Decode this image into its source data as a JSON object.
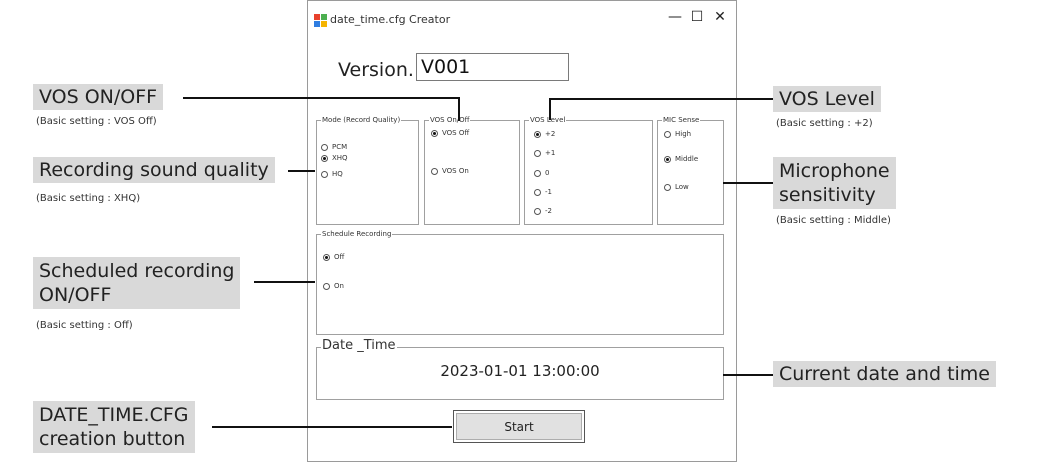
{
  "window": {
    "title": "date_time.cfg Creator",
    "controls": {
      "minimize": "—",
      "maximize": "☐",
      "close": "✕"
    },
    "icon_colors": [
      "#e8412c",
      "#4caf50",
      "#2f7de1",
      "#f5b400"
    ]
  },
  "version": {
    "label": "Version.",
    "value": "V001"
  },
  "groups": {
    "mode": {
      "title": "Mode (Record Quality)",
      "options": [
        {
          "label": "PCM",
          "selected": false
        },
        {
          "label": "XHQ",
          "selected": true
        },
        {
          "label": "HQ",
          "selected": false
        }
      ]
    },
    "vos_onoff": {
      "title": "VOS On/Off",
      "options": [
        {
          "label": "VOS Off",
          "selected": true
        },
        {
          "label": "VOS On",
          "selected": false
        }
      ]
    },
    "vos_level": {
      "title": "VOS Level",
      "options": [
        {
          "label": "+2",
          "selected": true
        },
        {
          "label": "+1",
          "selected": false
        },
        {
          "label": "0",
          "selected": false
        },
        {
          "label": "-1",
          "selected": false
        },
        {
          "label": "-2",
          "selected": false
        }
      ]
    },
    "mic_sense": {
      "title": "MIC Sense",
      "options": [
        {
          "label": "High",
          "selected": false
        },
        {
          "label": "Middle",
          "selected": true
        },
        {
          "label": "Low",
          "selected": false
        }
      ]
    },
    "schedule": {
      "title": "Schedule Recording",
      "options": [
        {
          "label": "Off",
          "selected": true
        },
        {
          "label": "On",
          "selected": false
        }
      ]
    },
    "datetime": {
      "title": "Date _Time",
      "value": "2023-01-01 13:00:00"
    }
  },
  "start_button": {
    "label": "Start"
  },
  "annotations": {
    "vos_onoff": {
      "title": "VOS ON/OFF",
      "note": "(Basic setting : VOS Off)"
    },
    "quality": {
      "title": "Recording sound quality",
      "note": "(Basic setting : XHQ)"
    },
    "schedule": {
      "title_line1": "Scheduled recording",
      "title_line2": "ON/OFF",
      "note": "(Basic setting : Off)"
    },
    "creation": {
      "title_line1": "DATE_TIME.CFG",
      "title_line2": "creation button"
    },
    "vos_level": {
      "title": "VOS Level",
      "note": "(Basic setting : +2)"
    },
    "mic": {
      "title_line1": "Microphone",
      "title_line2": "sensitivity",
      "note": "(Basic setting : Middle)"
    },
    "datetime": {
      "title": "Current date and time"
    }
  }
}
